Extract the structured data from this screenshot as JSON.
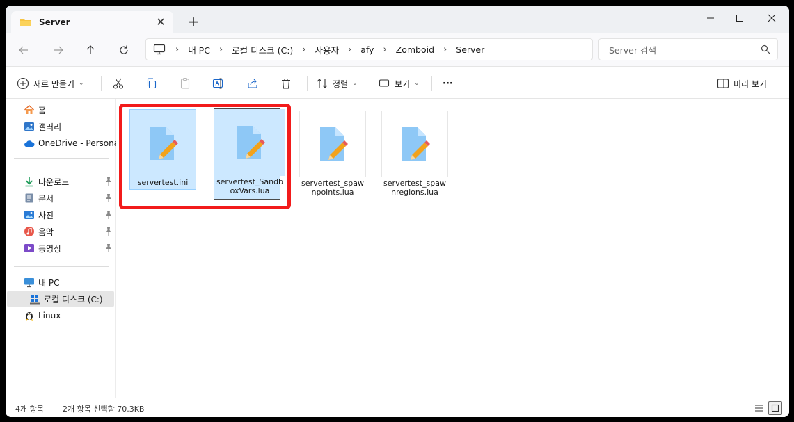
{
  "tab": {
    "title": "Server",
    "close": "✕",
    "add": "+"
  },
  "breadcrumb": [
    "내 PC",
    "로컬 디스크 (C:)",
    "사용자",
    "afy",
    "Zomboid",
    "Server"
  ],
  "breadcrumb_separator": "›",
  "search": {
    "placeholder": "Server 검색"
  },
  "commands": {
    "new": "새로 만들기",
    "sort": "정렬",
    "view": "보기",
    "more": "···",
    "preview": "미리 보기"
  },
  "sidebar": {
    "home": "홈",
    "gallery": "갤러리",
    "onedrive": "OneDrive - Personal",
    "downloads": "다운로드",
    "documents": "문서",
    "pictures": "사진",
    "music": "음악",
    "videos": "동영상",
    "this_pc": "내 PC",
    "local_disk": "로컬 디스크 (C:)",
    "linux": "Linux"
  },
  "files": [
    {
      "name": "servertest.ini",
      "selected": true
    },
    {
      "name": "servertest_SandboxVars.lua",
      "selected": true
    },
    {
      "name": "servertest_spawnpoints.lua",
      "selected": false
    },
    {
      "name": "servertest_spawnregions.lua",
      "selected": false
    }
  ],
  "status": {
    "count": "4개 항목",
    "selection": "2개 항목 선택함 70.3KB"
  },
  "colors": {
    "highlight": "#f21b1b",
    "selection": "#cce8ff",
    "folder": "#f7c443"
  }
}
